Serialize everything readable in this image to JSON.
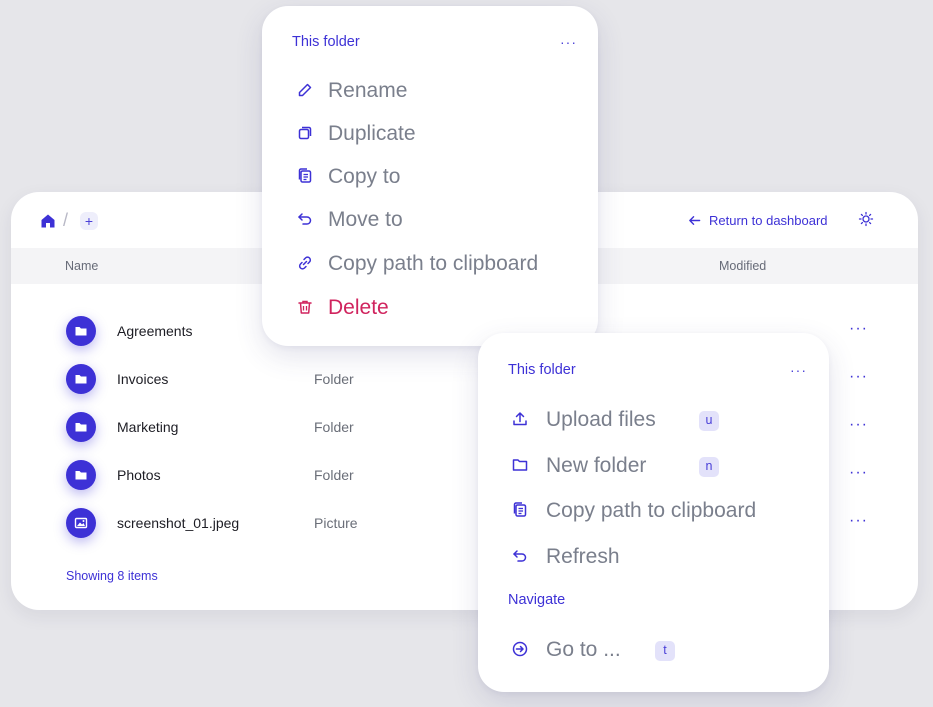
{
  "browser": {
    "breadcrumb_sep": "/",
    "add_crumb": "+",
    "return_label": "Return to dashboard",
    "columns": {
      "name": "Name",
      "modified": "Modified"
    },
    "rows": [
      {
        "name": "Agreements",
        "type": "",
        "icon": "folder-icon"
      },
      {
        "name": "Invoices",
        "type": "Folder",
        "icon": "folder-icon"
      },
      {
        "name": "Marketing",
        "type": "Folder",
        "icon": "folder-icon"
      },
      {
        "name": "Photos",
        "type": "Folder",
        "icon": "folder-icon"
      },
      {
        "name": "screenshot_01.jpeg",
        "type": "Picture",
        "icon": "image-icon"
      }
    ],
    "row_more": "···",
    "showing": "Showing 8 items"
  },
  "menu1": {
    "title": "This folder",
    "more": "···",
    "items": [
      {
        "label": "Rename",
        "icon": "pencil-icon"
      },
      {
        "label": "Duplicate",
        "icon": "duplicate-icon"
      },
      {
        "label": "Copy to",
        "icon": "copy-icon"
      },
      {
        "label": "Move to",
        "icon": "undo-arrow-icon"
      },
      {
        "label": "Copy path to clipboard",
        "icon": "link-icon"
      },
      {
        "label": "Delete",
        "icon": "trash-icon"
      }
    ]
  },
  "menu2": {
    "title": "This folder",
    "more": "···",
    "items": [
      {
        "label": "Upload files",
        "icon": "upload-icon",
        "shortcut": "u"
      },
      {
        "label": "New folder",
        "icon": "folder-outline-icon",
        "shortcut": "n"
      },
      {
        "label": "Copy path to clipboard",
        "icon": "copy-icon"
      },
      {
        "label": "Refresh",
        "icon": "undo-arrow-icon"
      }
    ],
    "navigate_label": "Navigate",
    "goto": {
      "label": "Go to ...",
      "icon": "arrow-circle-icon",
      "shortcut": "t"
    }
  },
  "colors": {
    "accent": "#3d31d6",
    "danger": "#d0245e",
    "muted_text": "#7a7f8c",
    "background": "#e6e6ea"
  }
}
